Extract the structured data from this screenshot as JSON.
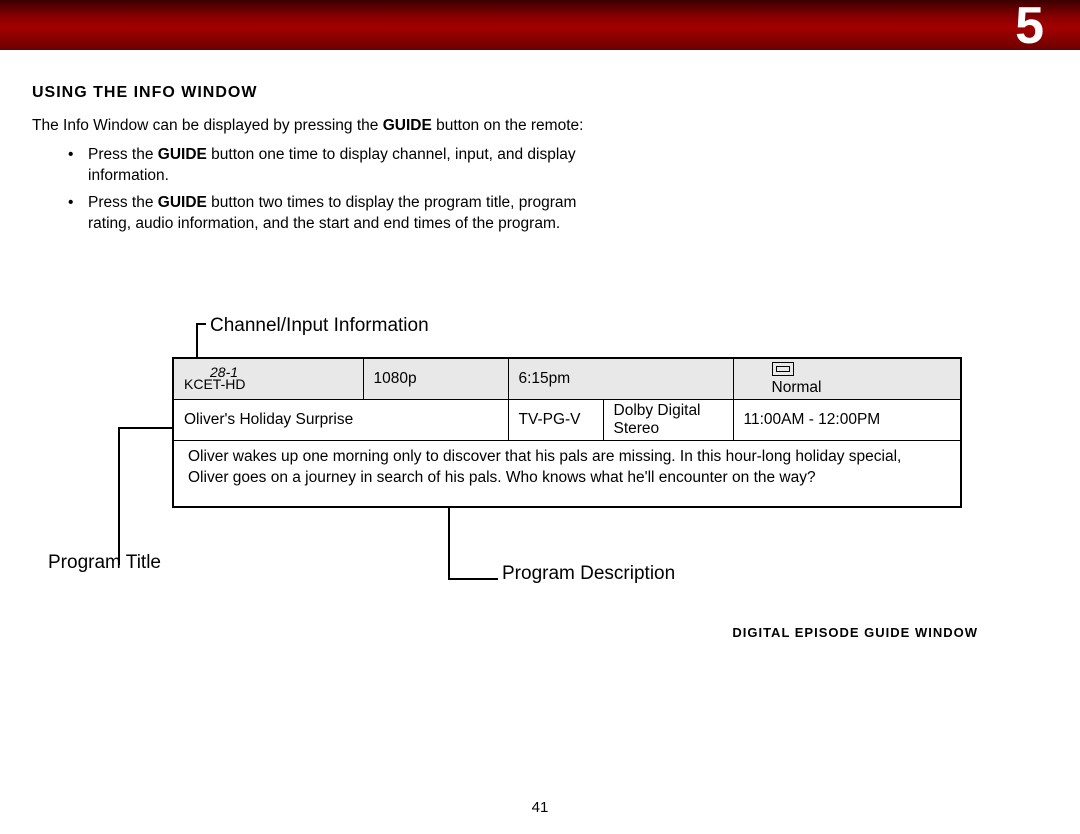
{
  "chapter_number": "5",
  "section_heading": "USING THE INFO WINDOW",
  "intro_line1": "The Info Window can be displayed by pressing the ",
  "intro_bold1": "GUIDE",
  "intro_line2": " button on the remote:",
  "bullet1_a": "Press the ",
  "bullet1_bold": "GUIDE",
  "bullet1_b": " button one time to display channel, input, and display information.",
  "bullet2_a": "Press the ",
  "bullet2_bold": "GUIDE",
  "bullet2_b": " button two times to display the program title, program rating, audio information, and the start and end times of the program.",
  "callouts": {
    "channel": "Channel/Input Information",
    "title": "Program Title",
    "description": "Program Description"
  },
  "info": {
    "channel_number": "28-1",
    "channel_name": "KCET-HD",
    "resolution": "1080p",
    "time": "6:15pm",
    "aspect_label": "Normal",
    "program_title": "Oliver's Holiday Surprise",
    "rating": "TV-PG-V",
    "audio": "Dolby Digital Stereo",
    "timeslot": "11:00AM - 12:00PM",
    "description": "Oliver wakes up one morning only to discover that his pals are missing. In this hour-long holiday special, Oliver goes on a journey in search of his pals. Who knows what he'll encounter on the way?"
  },
  "figure_caption": "DIGITAL EPISODE GUIDE WINDOW",
  "page_number": "41"
}
